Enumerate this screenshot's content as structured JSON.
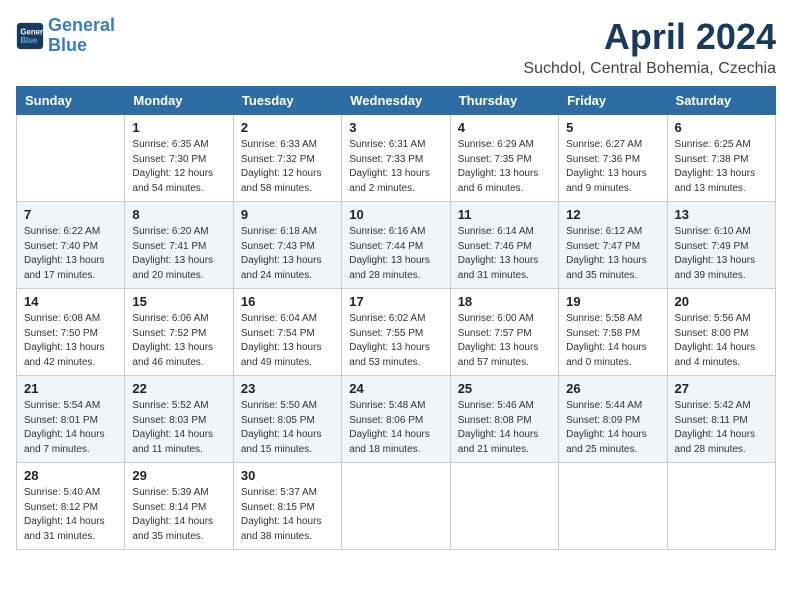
{
  "header": {
    "logo_line1": "General",
    "logo_line2": "Blue",
    "title": "April 2024",
    "subtitle": "Suchdol, Central Bohemia, Czechia"
  },
  "weekdays": [
    "Sunday",
    "Monday",
    "Tuesday",
    "Wednesday",
    "Thursday",
    "Friday",
    "Saturday"
  ],
  "weeks": [
    [
      {
        "day": "",
        "info": ""
      },
      {
        "day": "1",
        "info": "Sunrise: 6:35 AM\nSunset: 7:30 PM\nDaylight: 12 hours\nand 54 minutes."
      },
      {
        "day": "2",
        "info": "Sunrise: 6:33 AM\nSunset: 7:32 PM\nDaylight: 12 hours\nand 58 minutes."
      },
      {
        "day": "3",
        "info": "Sunrise: 6:31 AM\nSunset: 7:33 PM\nDaylight: 13 hours\nand 2 minutes."
      },
      {
        "day": "4",
        "info": "Sunrise: 6:29 AM\nSunset: 7:35 PM\nDaylight: 13 hours\nand 6 minutes."
      },
      {
        "day": "5",
        "info": "Sunrise: 6:27 AM\nSunset: 7:36 PM\nDaylight: 13 hours\nand 9 minutes."
      },
      {
        "day": "6",
        "info": "Sunrise: 6:25 AM\nSunset: 7:38 PM\nDaylight: 13 hours\nand 13 minutes."
      }
    ],
    [
      {
        "day": "7",
        "info": "Sunrise: 6:22 AM\nSunset: 7:40 PM\nDaylight: 13 hours\nand 17 minutes."
      },
      {
        "day": "8",
        "info": "Sunrise: 6:20 AM\nSunset: 7:41 PM\nDaylight: 13 hours\nand 20 minutes."
      },
      {
        "day": "9",
        "info": "Sunrise: 6:18 AM\nSunset: 7:43 PM\nDaylight: 13 hours\nand 24 minutes."
      },
      {
        "day": "10",
        "info": "Sunrise: 6:16 AM\nSunset: 7:44 PM\nDaylight: 13 hours\nand 28 minutes."
      },
      {
        "day": "11",
        "info": "Sunrise: 6:14 AM\nSunset: 7:46 PM\nDaylight: 13 hours\nand 31 minutes."
      },
      {
        "day": "12",
        "info": "Sunrise: 6:12 AM\nSunset: 7:47 PM\nDaylight: 13 hours\nand 35 minutes."
      },
      {
        "day": "13",
        "info": "Sunrise: 6:10 AM\nSunset: 7:49 PM\nDaylight: 13 hours\nand 39 minutes."
      }
    ],
    [
      {
        "day": "14",
        "info": "Sunrise: 6:08 AM\nSunset: 7:50 PM\nDaylight: 13 hours\nand 42 minutes."
      },
      {
        "day": "15",
        "info": "Sunrise: 6:06 AM\nSunset: 7:52 PM\nDaylight: 13 hours\nand 46 minutes."
      },
      {
        "day": "16",
        "info": "Sunrise: 6:04 AM\nSunset: 7:54 PM\nDaylight: 13 hours\nand 49 minutes."
      },
      {
        "day": "17",
        "info": "Sunrise: 6:02 AM\nSunset: 7:55 PM\nDaylight: 13 hours\nand 53 minutes."
      },
      {
        "day": "18",
        "info": "Sunrise: 6:00 AM\nSunset: 7:57 PM\nDaylight: 13 hours\nand 57 minutes."
      },
      {
        "day": "19",
        "info": "Sunrise: 5:58 AM\nSunset: 7:58 PM\nDaylight: 14 hours\nand 0 minutes."
      },
      {
        "day": "20",
        "info": "Sunrise: 5:56 AM\nSunset: 8:00 PM\nDaylight: 14 hours\nand 4 minutes."
      }
    ],
    [
      {
        "day": "21",
        "info": "Sunrise: 5:54 AM\nSunset: 8:01 PM\nDaylight: 14 hours\nand 7 minutes."
      },
      {
        "day": "22",
        "info": "Sunrise: 5:52 AM\nSunset: 8:03 PM\nDaylight: 14 hours\nand 11 minutes."
      },
      {
        "day": "23",
        "info": "Sunrise: 5:50 AM\nSunset: 8:05 PM\nDaylight: 14 hours\nand 15 minutes."
      },
      {
        "day": "24",
        "info": "Sunrise: 5:48 AM\nSunset: 8:06 PM\nDaylight: 14 hours\nand 18 minutes."
      },
      {
        "day": "25",
        "info": "Sunrise: 5:46 AM\nSunset: 8:08 PM\nDaylight: 14 hours\nand 21 minutes."
      },
      {
        "day": "26",
        "info": "Sunrise: 5:44 AM\nSunset: 8:09 PM\nDaylight: 14 hours\nand 25 minutes."
      },
      {
        "day": "27",
        "info": "Sunrise: 5:42 AM\nSunset: 8:11 PM\nDaylight: 14 hours\nand 28 minutes."
      }
    ],
    [
      {
        "day": "28",
        "info": "Sunrise: 5:40 AM\nSunset: 8:12 PM\nDaylight: 14 hours\nand 31 minutes."
      },
      {
        "day": "29",
        "info": "Sunrise: 5:39 AM\nSunset: 8:14 PM\nDaylight: 14 hours\nand 35 minutes."
      },
      {
        "day": "30",
        "info": "Sunrise: 5:37 AM\nSunset: 8:15 PM\nDaylight: 14 hours\nand 38 minutes."
      },
      {
        "day": "",
        "info": ""
      },
      {
        "day": "",
        "info": ""
      },
      {
        "day": "",
        "info": ""
      },
      {
        "day": "",
        "info": ""
      }
    ]
  ]
}
